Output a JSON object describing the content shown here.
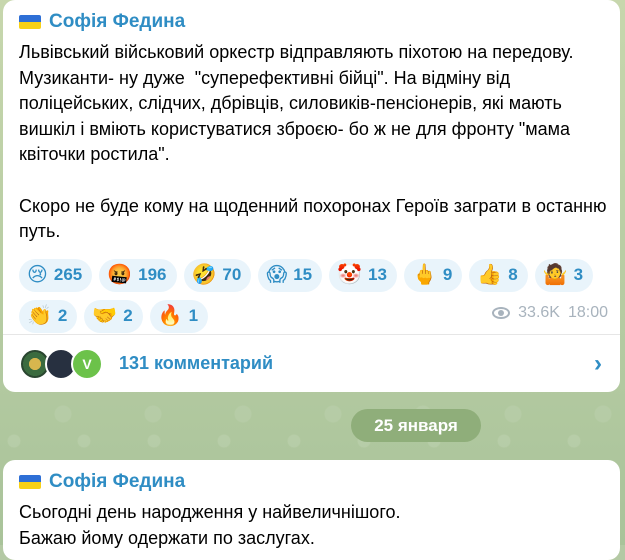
{
  "message1": {
    "author": "Софія Федина",
    "text": "Львівський військовий оркестр відправляють піхотою на передову. Музиканти- ну дуже  \"суперефективні бійці\". На відміну від поліцейських, слідчих, дбрівців, силовиків-пенсіонерів, які мають вишкіл і вміють користуватися зброєю- бо ж не для фронту \"мама квіточки ростила\".\n\nСкоро не буде кому на щоденний похоронах Героїв заграти в останню путь.",
    "reactions": [
      {
        "emoji": "😢",
        "count": "265"
      },
      {
        "emoji": "🤬",
        "count": "196"
      },
      {
        "emoji": "🤣",
        "count": "70"
      },
      {
        "emoji": "😱",
        "count": "15"
      },
      {
        "emoji": "🤡",
        "count": "13"
      },
      {
        "emoji": "🖕",
        "count": "9"
      },
      {
        "emoji": "👍",
        "count": "8"
      },
      {
        "emoji": "🤷",
        "count": "3"
      },
      {
        "emoji": "👏",
        "count": "2"
      },
      {
        "emoji": "🤝",
        "count": "2"
      },
      {
        "emoji": "🔥",
        "count": "1"
      }
    ],
    "views": "33.6K",
    "time": "18:00",
    "comments_label": "131 комментарий",
    "avatar_v": "V"
  },
  "date_separator": "25 января",
  "message2": {
    "author": "Софія Федина",
    "text": "Сьогодні день народження у найвеличнішого.\nБажаю йому одержати по заслугах."
  },
  "colors": {
    "accent": "#2f8dc4",
    "chip_bg": "#e9f4fb",
    "bg": "#b4c9a4"
  }
}
